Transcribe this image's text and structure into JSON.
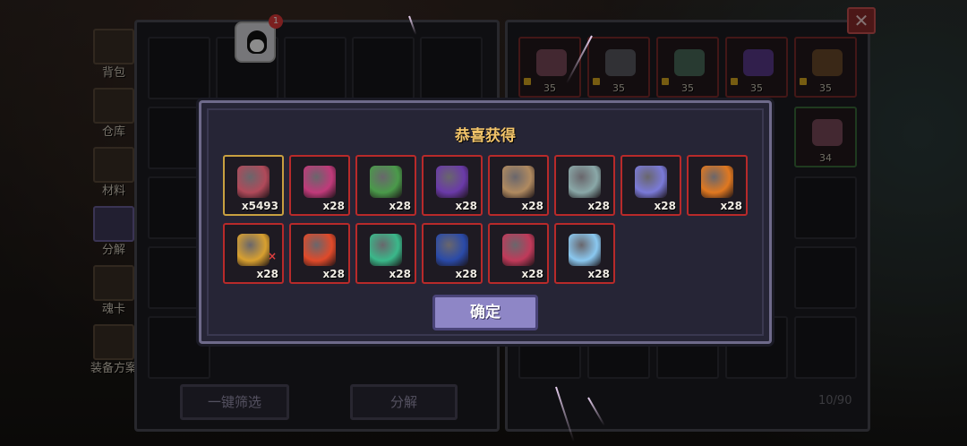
{
  "sidebar": {
    "items": [
      {
        "label": "背包",
        "icon": "chest-icon"
      },
      {
        "label": "仓库",
        "icon": "warehouse-icon"
      },
      {
        "label": "材料",
        "icon": "materials-icon"
      },
      {
        "label": "分解",
        "icon": "pumpkin-icon",
        "active": true
      },
      {
        "label": "魂卡",
        "icon": "soul-card-icon"
      },
      {
        "label": "装备方案",
        "icon": "crossed-swords-icon"
      }
    ]
  },
  "notification": {
    "badge_count": "1",
    "icon": "qq-penguin-icon"
  },
  "left_panel": {
    "filter_button": "一键筛选",
    "decompose_button": "分解"
  },
  "right_panel": {
    "items": [
      {
        "count": "35",
        "locked": true,
        "icon": "bat-wing-icon"
      },
      {
        "count": "35",
        "locked": true,
        "icon": "ghost-beast-icon"
      },
      {
        "count": "35",
        "locked": true,
        "icon": "gem-necklace-icon"
      },
      {
        "count": "35",
        "locked": true,
        "icon": "octopus-icon"
      },
      {
        "count": "35",
        "locked": true,
        "icon": "bead-ring-icon"
      },
      {
        "count": "34",
        "locked": false,
        "icon": "bat-wing-icon"
      }
    ],
    "capacity": "10/90"
  },
  "modal": {
    "title": "恭喜获得",
    "confirm_label": "确定",
    "rewards": [
      {
        "qty": "x5493",
        "icon": "red-crystal-icon",
        "color": "#b04a5a",
        "frame": "gold"
      },
      {
        "qty": "x28",
        "icon": "pink-sword-icon",
        "color": "#c03a7a",
        "frame": "red"
      },
      {
        "qty": "x28",
        "icon": "green-bow-icon",
        "color": "#4a9a4a",
        "frame": "red"
      },
      {
        "qty": "x28",
        "icon": "purple-blade-icon",
        "color": "#6a3aa8",
        "frame": "red"
      },
      {
        "qty": "x28",
        "icon": "teddy-bear-icon",
        "color": "#b08a60",
        "frame": "red"
      },
      {
        "qty": "x28",
        "icon": "silver-staff-icon",
        "color": "#8aa8a8",
        "frame": "red"
      },
      {
        "qty": "x28",
        "icon": "crystal-wand-icon",
        "color": "#7a7ad8",
        "frame": "red"
      },
      {
        "qty": "x28",
        "icon": "pumpkin-icon",
        "color": "#e07820",
        "frame": "red"
      },
      {
        "qty": "x28",
        "icon": "flame-sword-icon",
        "color": "#d8a030",
        "frame": "red",
        "cross": "×"
      },
      {
        "qty": "x28",
        "icon": "fire-flower-icon",
        "color": "#e04a2a",
        "frame": "red"
      },
      {
        "qty": "x28",
        "icon": "jade-blade-icon",
        "color": "#3ab88a",
        "frame": "red"
      },
      {
        "qty": "x28",
        "icon": "blue-flame-icon",
        "color": "#2a4aa8",
        "frame": "red"
      },
      {
        "qty": "x28",
        "icon": "berry-icon",
        "color": "#c03a5a",
        "frame": "red"
      },
      {
        "qty": "x28",
        "icon": "ice-orb-icon",
        "color": "#8ac8f0",
        "frame": "red"
      }
    ]
  }
}
